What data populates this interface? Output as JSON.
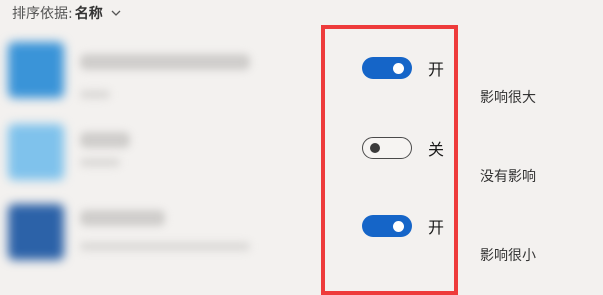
{
  "sort": {
    "label": "排序依据:",
    "value": "名称"
  },
  "colors": {
    "accent": "#1565c8",
    "highlight_border": "#ee3b3b"
  },
  "apps": [
    {
      "icon_color": "#3a94d8",
      "blurred": true
    },
    {
      "icon_color": "#7fc2ec",
      "blurred": true
    },
    {
      "icon_color": "#2c62a8",
      "blurred": true
    }
  ],
  "toggles": [
    {
      "state": "on",
      "label": "开"
    },
    {
      "state": "off",
      "label": "关"
    },
    {
      "state": "on",
      "label": "开"
    }
  ],
  "impacts": [
    "影响很大",
    "没有影响",
    "影响很小"
  ]
}
